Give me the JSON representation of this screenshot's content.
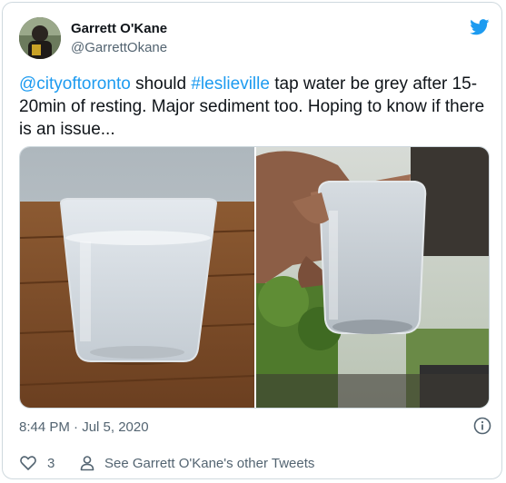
{
  "user": {
    "name": "Garrett O'Kane",
    "handle": "@GarrettOkane"
  },
  "tweet": {
    "mention": "@cityoftoronto",
    "text_1": " should ",
    "hashtag": "#leslieville",
    "text_2": " tap water be grey after 15-20min of resting. Major sediment too. Hoping to know if there is an issue..."
  },
  "meta": {
    "timestamp": "8:44 PM · Jul 5, 2020"
  },
  "actions": {
    "like_count": "3",
    "other_tweets": "See Garrett O'Kane's other Tweets"
  },
  "colors": {
    "accent": "#1d9bf0",
    "secondary_text": "#536471",
    "border": "#cfd9de"
  },
  "icons": [
    "twitter-bird-icon",
    "info-icon",
    "heart-icon",
    "person-icon"
  ]
}
